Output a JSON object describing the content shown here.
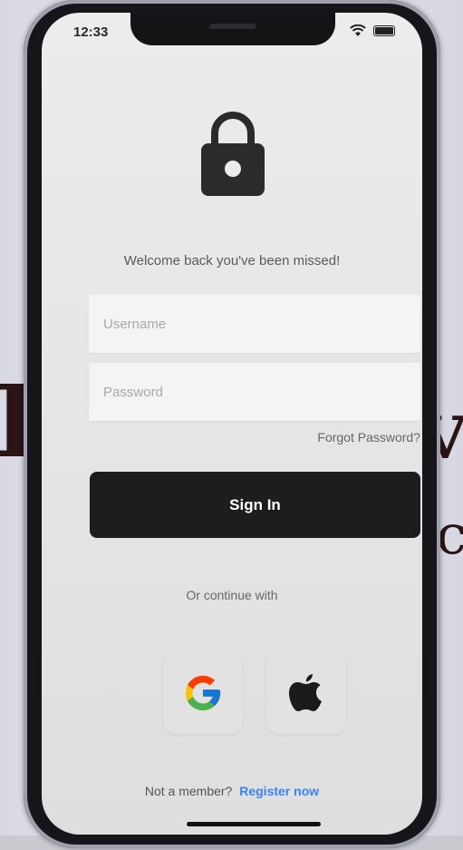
{
  "status_bar": {
    "time": "12:33",
    "wifi_icon": "wifi-icon",
    "battery_icon": "battery-icon"
  },
  "header": {
    "icon": "lock-icon",
    "welcome_text": "Welcome back you've been missed!"
  },
  "form": {
    "username_placeholder": "Username",
    "password_placeholder": "Password",
    "forgot_password": "Forgot Password?",
    "sign_in_label": "Sign In"
  },
  "social": {
    "continue_text": "Or continue with",
    "providers": [
      {
        "name": "google",
        "icon": "google-icon"
      },
      {
        "name": "apple",
        "icon": "apple-icon"
      }
    ]
  },
  "footer": {
    "not_member": "Not a member?",
    "register_now": "Register now"
  },
  "colors": {
    "primary_button": "#1d1d1f",
    "link": "#3b82f6",
    "background": "#e8e8e8"
  }
}
